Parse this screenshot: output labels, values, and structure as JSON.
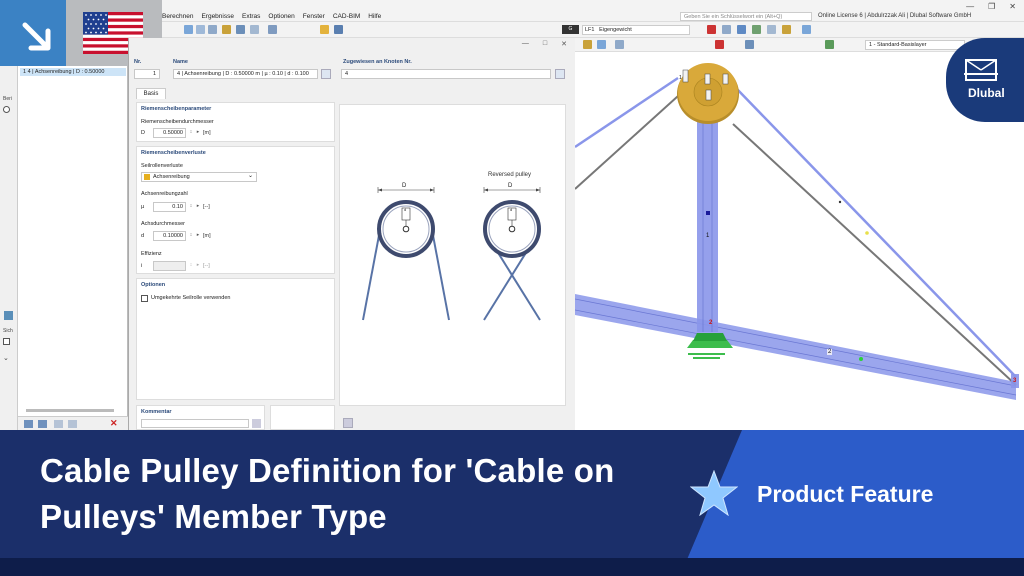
{
  "menu": [
    "Berechnen",
    "Ergebnisse",
    "Extras",
    "Optionen",
    "Fenster",
    "CAD-BIM",
    "Hilfe"
  ],
  "search_placeholder": "Geben Sie ein Schlüsselwort ein (Alt+Q)",
  "license": "Online License 6 | Abdulrzzak Ali | Dlubal Software GmbH",
  "load_case": {
    "code": "G",
    "id": "LF1",
    "name": "Eigengewicht"
  },
  "layer": "1 - Standard-Basislayer",
  "nav": {
    "item": "1  4 | Achsenreibung | D : 0.50000",
    "side_labels": [
      "Beri",
      "Sich"
    ]
  },
  "dialog": {
    "no_label": "Nr.",
    "no_value": "1",
    "name_label": "Name",
    "name_value": "4 | Achsenreibung | D : 0.50000 m | µ : 0.10 | d : 0.100",
    "assigned_label": "Zugewiesen an Knoten Nr.",
    "assigned_value": "4",
    "tab": "Basis",
    "pulley_params_title": "Riemenscheibenparameter",
    "diameter_label": "Riemenscheibendurchmesser",
    "diameter_symbol": "D",
    "diameter_value": "0.50000",
    "diameter_unit": "[m]",
    "losses_title": "Riemenscheibenverluste",
    "rope_losses_label": "Seilrollenverluste",
    "rope_losses_value": "Achsenreibung",
    "friction_label": "Achsenreibungzahl",
    "friction_symbol": "µ",
    "friction_value": "0.10",
    "friction_unit": "[--]",
    "axle_label": "Achsdurchmesser",
    "axle_symbol": "d",
    "axle_value": "0.10000",
    "axle_unit": "[m]",
    "eff_label": "Effizienz",
    "eff_symbol": "i",
    "eff_unit": "[--]",
    "options_title": "Optionen",
    "reverse_label": "Umgekehrte Seilrolle verwenden",
    "comment_title": "Kommentar",
    "preview_D": "D",
    "preview_d": "d",
    "preview_reversed": "Reversed pulley"
  },
  "model_labels": {
    "node1": "1",
    "node2": "2",
    "node3": "3",
    "member1": "1",
    "member2": "2"
  },
  "logo": "Dlubal",
  "banner": {
    "title_line1": "Cable Pulley Definition for 'Cable on",
    "title_line2": "Pulleys' Member Type",
    "feature": "Product Feature"
  },
  "colors": {
    "banner": "#1b2f6a",
    "accent": "#2c5cc9",
    "member": "#8a96ea",
    "pulley": "#d9a93a"
  }
}
